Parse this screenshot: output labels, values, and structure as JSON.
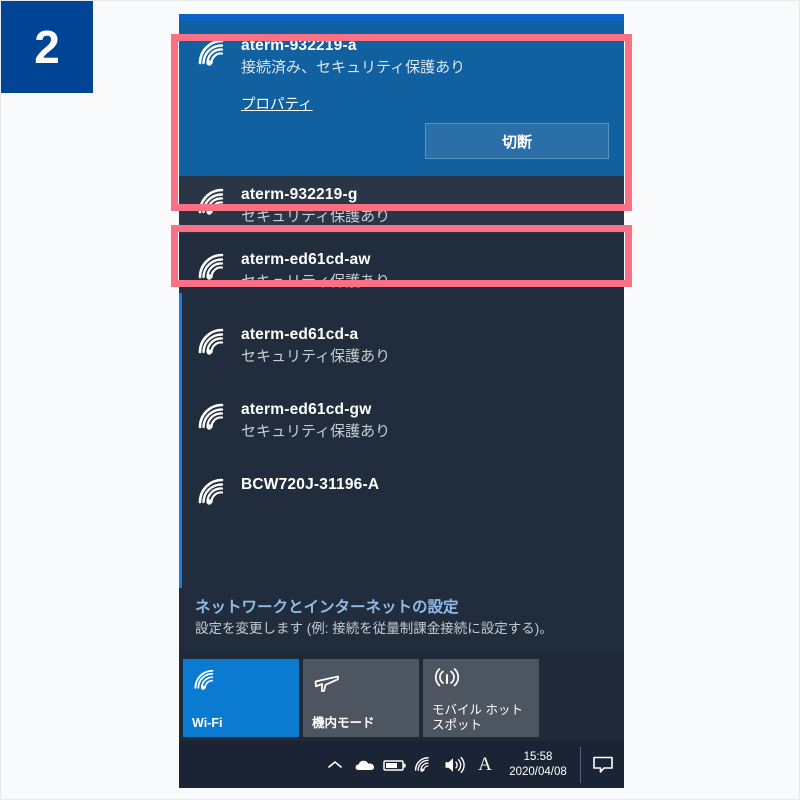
{
  "step": {
    "number": "2"
  },
  "colors": {
    "badge_bg": "#004595",
    "highlight": "#fc7086",
    "panel_bg": "#212d3c",
    "connected_row_bg": "#11609f",
    "accent_blue": "#0b7ad1",
    "link_blue": "#8fbce8"
  },
  "flyout": {
    "networks": [
      {
        "name": "aterm-932219-a",
        "status": "接続済み、セキュリティ保護あり",
        "state": "connected",
        "properties_label": "プロパティ",
        "disconnect_label": "切断",
        "icon": "wifi-icon"
      },
      {
        "name": "aterm-932219-g",
        "status": "セキュリティ保護あり",
        "state": "hover",
        "icon": "wifi-icon"
      },
      {
        "name": "aterm-ed61cd-aw",
        "status": "セキュリティ保護あり",
        "state": "normal",
        "icon": "wifi-icon"
      },
      {
        "name": "aterm-ed61cd-a",
        "status": "セキュリティ保護あり",
        "state": "normal",
        "icon": "wifi-icon"
      },
      {
        "name": "aterm-ed61cd-gw",
        "status": "セキュリティ保護あり",
        "state": "normal",
        "icon": "wifi-icon"
      },
      {
        "name": "BCW720J-31196-A",
        "status": "",
        "state": "normal",
        "icon": "wifi-icon"
      }
    ],
    "settings": {
      "title": "ネットワークとインターネットの設定",
      "subtitle": "設定を変更します (例: 接続を従量制課金接続に設定する)。"
    },
    "quick_tiles": [
      {
        "label": "Wi-Fi",
        "icon": "wifi-icon",
        "active": true
      },
      {
        "label": "機内モード",
        "icon": "airplane-icon",
        "active": false
      },
      {
        "label": "モバイル ホットスポット",
        "icon": "hotspot-icon",
        "active": false
      }
    ]
  },
  "taskbar": {
    "tray_icons": [
      {
        "name": "chevron-up-icon"
      },
      {
        "name": "cloud-icon"
      },
      {
        "name": "battery-icon"
      },
      {
        "name": "wifi-icon"
      },
      {
        "name": "speaker-icon"
      },
      {
        "name": "ime-icon",
        "label": "A"
      }
    ],
    "clock": {
      "time": "15:58",
      "date": "2020/04/08"
    },
    "notifications_icon": "notification-icon"
  }
}
